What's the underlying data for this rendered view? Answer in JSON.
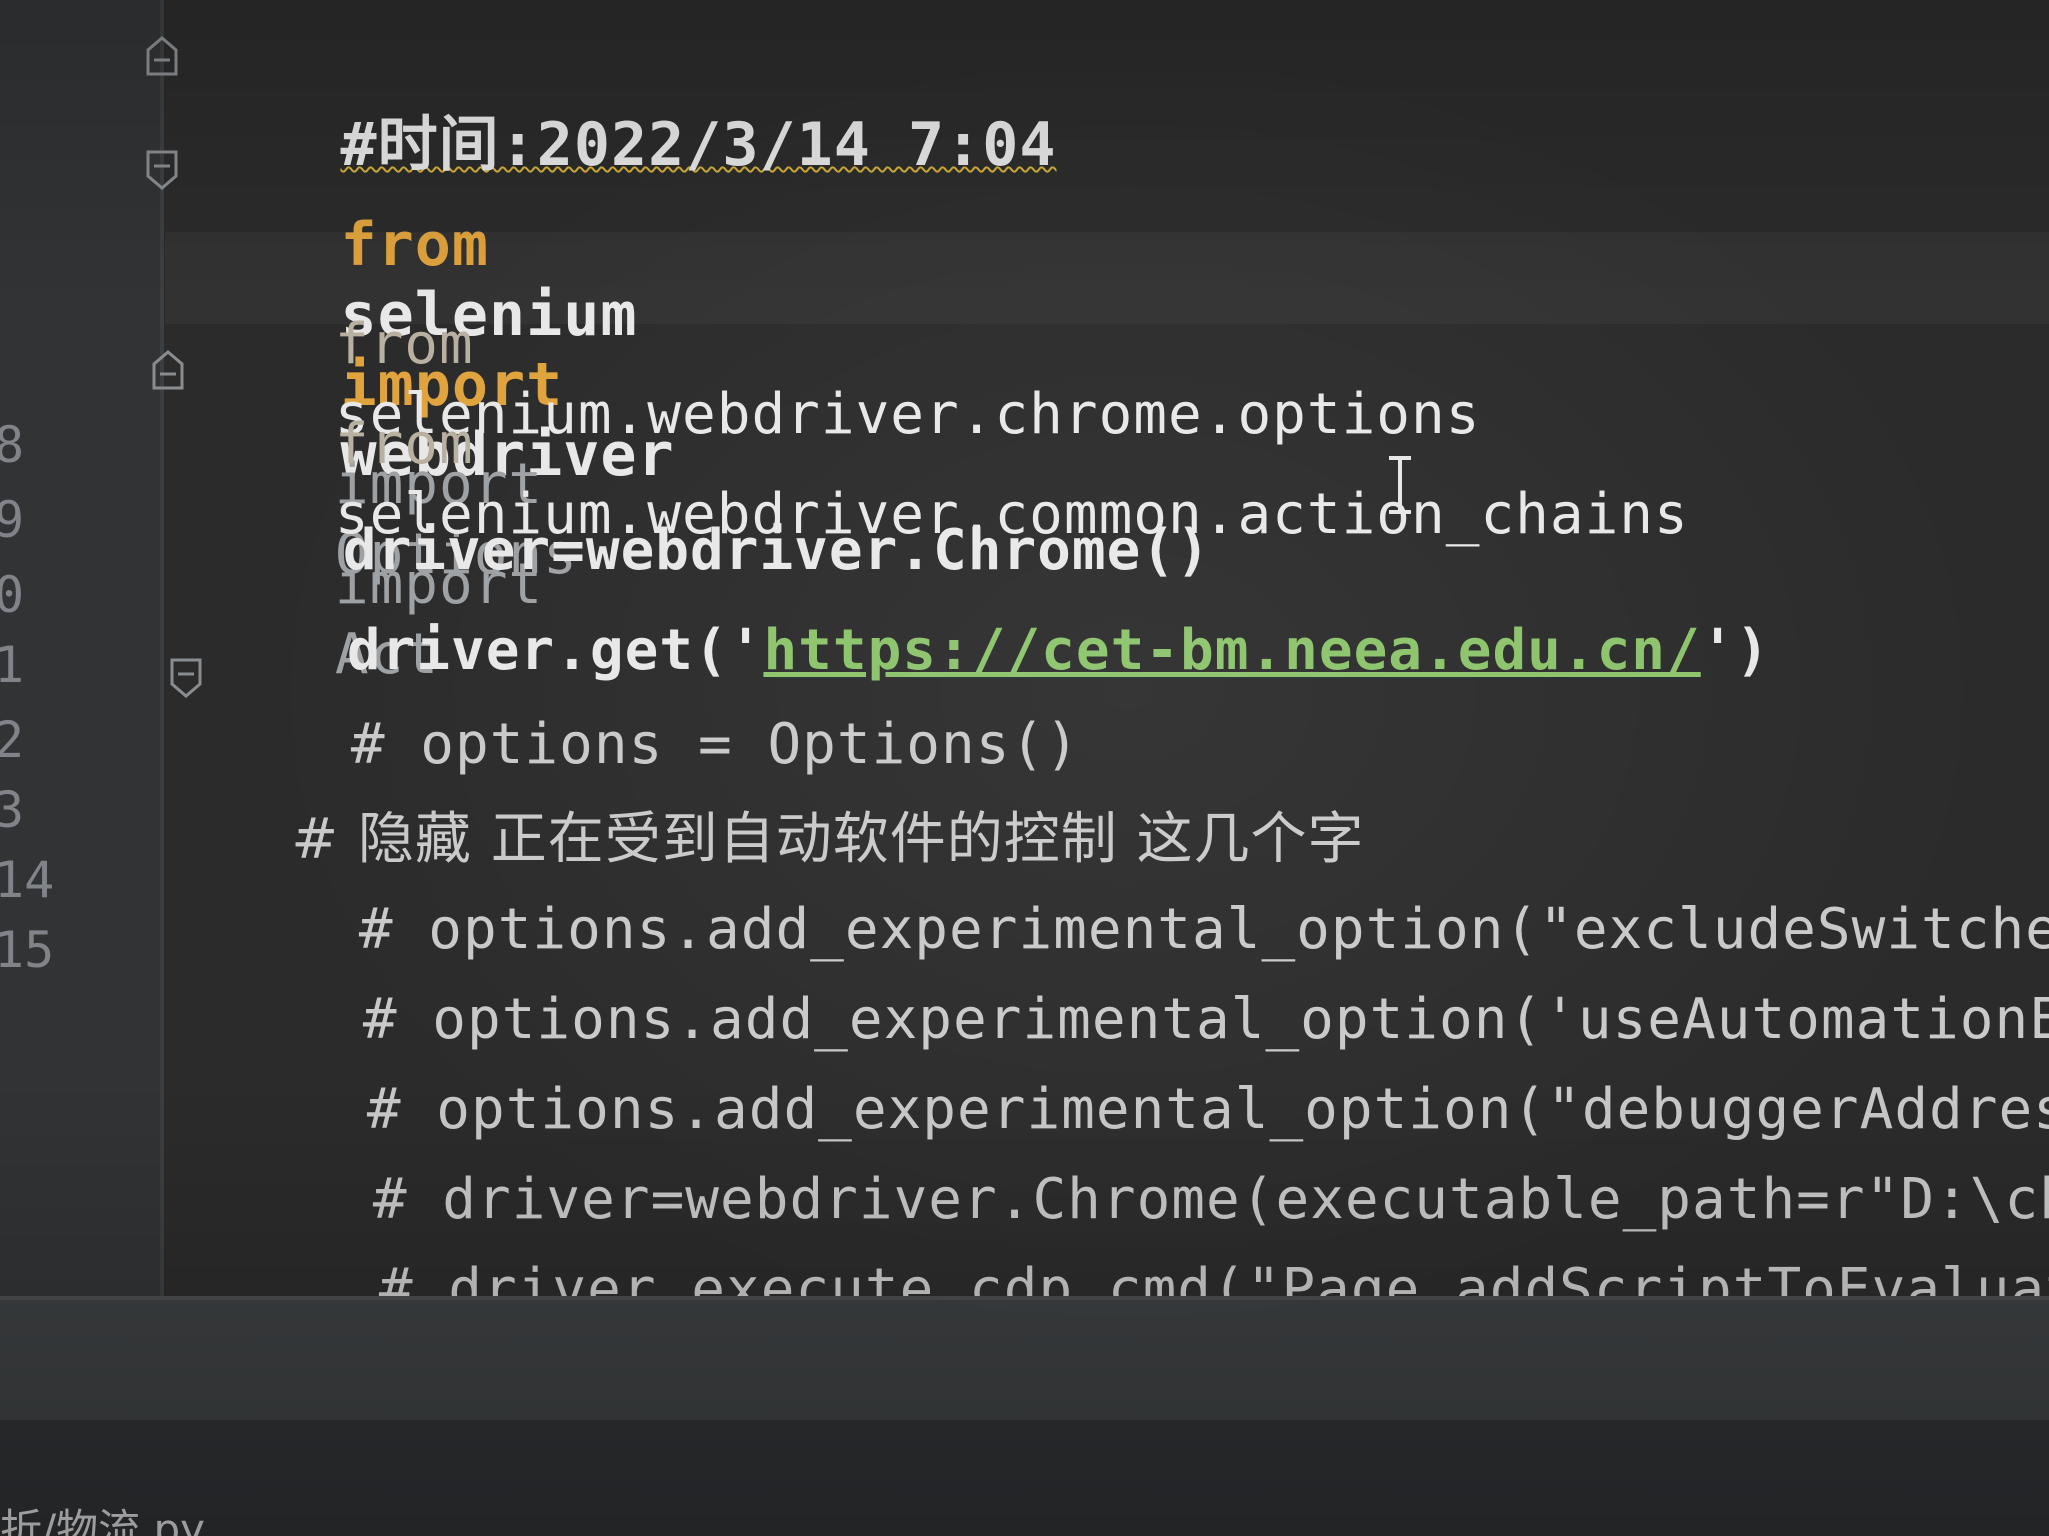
{
  "editor": {
    "lines": [
      {
        "kind": "header-comment",
        "text": "#时间:2022/3/14 7:04"
      },
      {
        "kind": "import-main",
        "from_kw": "from",
        "module": "selenium",
        "import_kw": "import",
        "name": "webdriver"
      },
      {
        "kind": "import",
        "from_kw": "from",
        "module": "selenium.webdriver.chrome.options",
        "import_kw": "import",
        "name": "Options"
      },
      {
        "kind": "import",
        "from_kw": "from",
        "module": "selenium.webdriver.common.action_chains",
        "import_kw": "import",
        "name": "Act"
      },
      {
        "kind": "code",
        "text": "driver=webdriver.Chrome()"
      },
      {
        "kind": "code-url",
        "prefix": "driver.get('",
        "url": "https://cet-bm.neea.edu.cn/",
        "suffix": "')"
      },
      {
        "kind": "comment",
        "text": "# options = Options()"
      },
      {
        "kind": "comment",
        "text": "# 隐藏 正在受到自动软件的控制 这几个字"
      },
      {
        "kind": "comment",
        "text": "# options.add_experimental_option(\"excludeSwitches\", [\"e"
      },
      {
        "kind": "comment",
        "text": "# options.add_experimental_option('useAutomationExtensio"
      },
      {
        "kind": "comment",
        "text": "# options.add_experimental_option(\"debuggerAddress\", \"loc"
      },
      {
        "kind": "comment",
        "text": "# driver=webdriver.Chrome(executable_path=r\"D:\\chromedriv"
      },
      {
        "kind": "comment",
        "text": "# driver.execute_cdp_cmd(\"Page.addScriptToEvaluateOnNewDo"
      }
    ]
  },
  "gutter": {
    "line_numbers": [
      "8",
      "9",
      "0",
      "1",
      "2",
      "3",
      "14",
      "15"
    ]
  },
  "status": {
    "file_tab": "折/物流.py"
  },
  "icons": {
    "fold": "fold-marker-icon",
    "cursor": "text-cursor-icon"
  },
  "colors": {
    "keyword": "#e0a33d",
    "url": "#8cc36b",
    "background": "#2b2b2b",
    "gutter": "#313335"
  }
}
